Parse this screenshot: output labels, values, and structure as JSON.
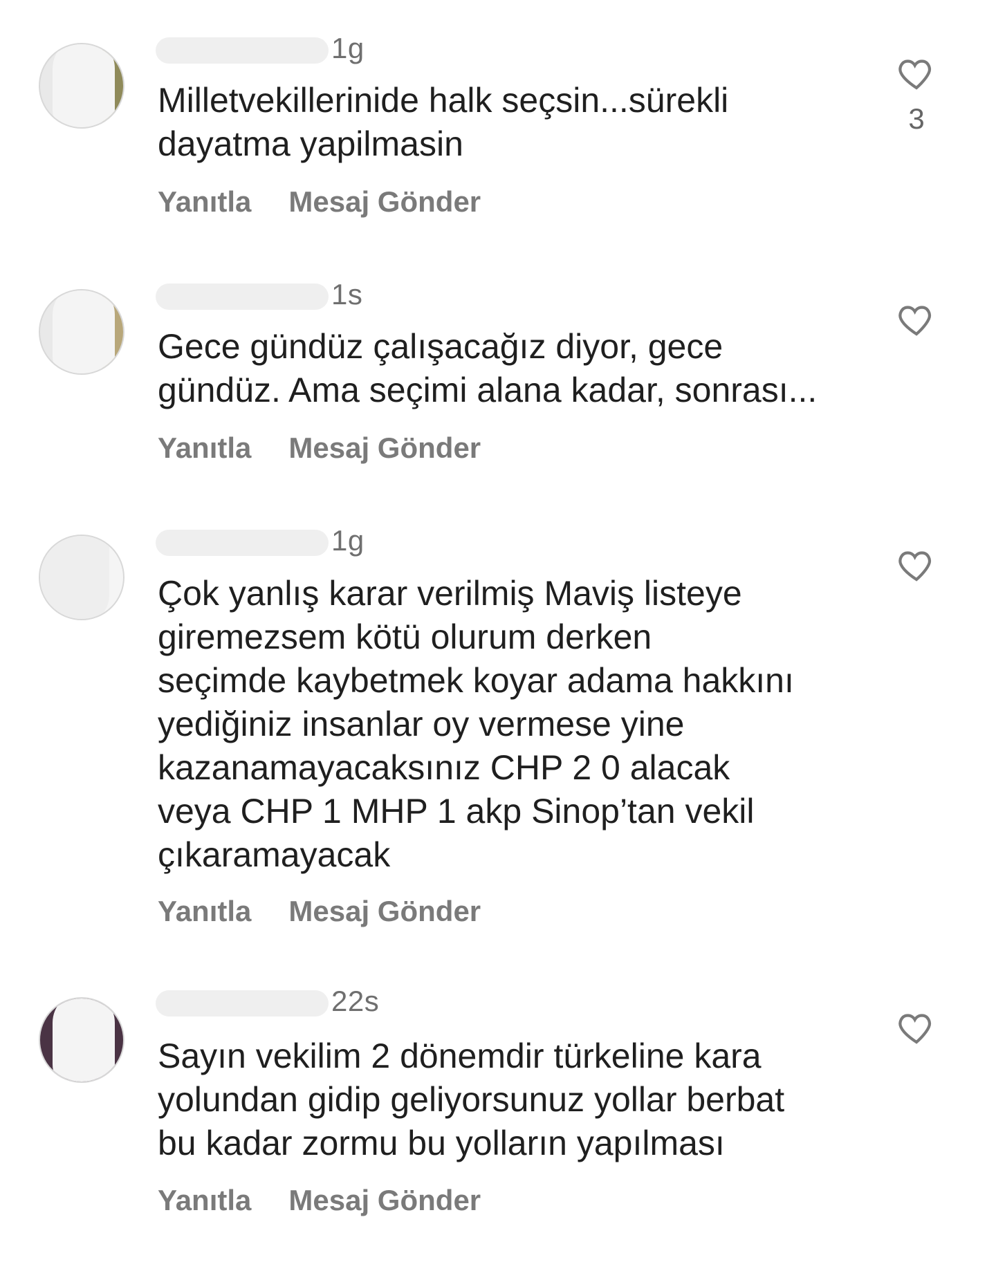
{
  "comments": [
    {
      "username_suffix": "1g",
      "text": "Milletvekillerinide halk seçsin...sürekli\ndayatma yapilmasin",
      "reply_label": "Yanıtla",
      "message_label": "Mesaj Gönder",
      "like_icon": "heart-outline",
      "likes": "3"
    },
    {
      "username_suffix": "1s",
      "text": "Gece gündüz çalışacağız diyor, gece\ngündüz. Ama seçimi alana kadar, sonrası...",
      "reply_label": "Yanıtla",
      "message_label": "Mesaj Gönder",
      "like_icon": "heart-outline"
    },
    {
      "username_suffix": "1g",
      "text": "Çok yanlış karar verilmiş Maviş listeye\ngiremezsem kötü olurum derken\nseçimde kaybetmek koyar adama hakkını\nyediğiniz insanlar oy vermese yine\nkazanamayacaksınız CHP 2 0 alacak\nveya CHP 1 MHP 1 akp Sinop’tan vekil\nçıkaramayacak",
      "reply_label": "Yanıtla",
      "message_label": "Mesaj Gönder",
      "like_icon": "heart-outline"
    },
    {
      "username_suffix": "22s",
      "text": "Sayın vekilim 2 dönemdir türkeline kara\nyolundan gidip geliyorsunuz yollar berbat\nbu kadar zormu bu yolların yapılması",
      "reply_label": "Yanıtla",
      "message_label": "Mesaj Gönder",
      "like_icon": "heart-outline"
    }
  ],
  "colors": {
    "text": "#1f1f1f",
    "meta": "#7a7a7a",
    "heart": "#7a7a7a"
  }
}
